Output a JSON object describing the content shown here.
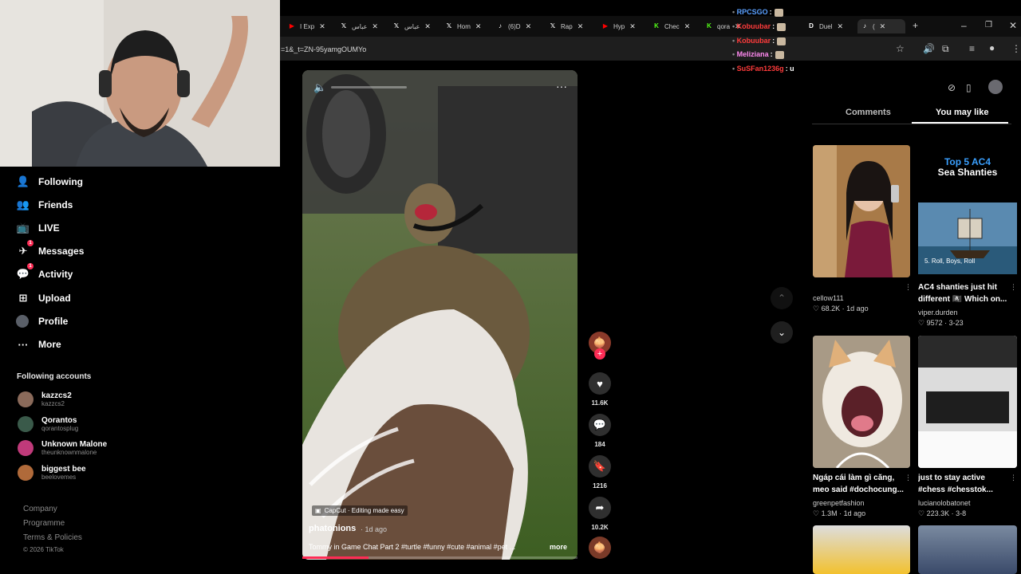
{
  "browser": {
    "tabs": [
      {
        "label": "I Exp",
        "icon": "youtube-icon",
        "color": "#ff0000"
      },
      {
        "label": "عباس",
        "icon": "x-logo-icon",
        "color": "#ffffff"
      },
      {
        "label": "عباس",
        "icon": "x-logo-icon",
        "color": "#ffffff"
      },
      {
        "label": "Hom",
        "icon": "x-logo-icon",
        "color": "#ffffff"
      },
      {
        "label": "(6)D",
        "icon": "tiktok-icon",
        "color": "#ffffff"
      },
      {
        "label": "Rap",
        "icon": "x-logo-icon",
        "color": "#ffffff"
      },
      {
        "label": "Hyp",
        "icon": "youtube-icon",
        "color": "#ff0000"
      },
      {
        "label": "Chec",
        "icon": "kick-icon",
        "color": "#53fc18"
      },
      {
        "label": "qora",
        "icon": "kick-icon",
        "color": "#53fc18"
      },
      {
        "label": "Duel",
        "icon": "d-icon",
        "color": "#ffffff"
      },
      {
        "label": "(",
        "icon": "tiktok-icon",
        "color": "#ffffff"
      }
    ],
    "url": "=1&_t=ZN-95yamgOUMYo"
  },
  "chat": [
    {
      "user": "RPCSGO",
      "text": ":",
      "color": "#5aa0ff"
    },
    {
      "user": "Kobuubar",
      "text": ":",
      "color": "#ff3b3b"
    },
    {
      "user": "Kobuubar",
      "text": ":",
      "color": "#ff3b3b"
    },
    {
      "user": "Meliziana",
      "text": ":",
      "color": "#ff8af0"
    },
    {
      "user": "SuSFan1236g",
      "text": ": u",
      "color": "#ff3b3b"
    }
  ],
  "sidebar": {
    "items": [
      {
        "label": "Following",
        "icon": "following-icon",
        "badge": "",
        "glyph": "👤"
      },
      {
        "label": "Friends",
        "icon": "friends-icon",
        "badge": "",
        "glyph": "👥"
      },
      {
        "label": "LIVE",
        "icon": "live-icon",
        "badge": "",
        "glyph": "📺"
      },
      {
        "label": "Messages",
        "icon": "messages-icon",
        "badge": "1",
        "glyph": "✈"
      },
      {
        "label": "Activity",
        "icon": "activity-icon",
        "badge": "1",
        "glyph": "💬"
      },
      {
        "label": "Upload",
        "icon": "upload-icon",
        "badge": "",
        "glyph": "⊞"
      },
      {
        "label": "Profile",
        "icon": "profile-avatar",
        "badge": "",
        "glyph": ""
      },
      {
        "label": "More",
        "icon": "more-icon",
        "badge": "",
        "glyph": "···"
      }
    ],
    "following_title": "Following accounts",
    "accounts": [
      {
        "name": "kazzcs2",
        "handle": "kazzcs2",
        "color": "#8a6a5a"
      },
      {
        "name": "Qorantos",
        "handle": "qorantosplug",
        "color": "#3a5a4a"
      },
      {
        "name": "Unknown Malone",
        "handle": "theunknownmalone",
        "color": "#c03a7a"
      },
      {
        "name": "biggest bee",
        "handle": "beelovemes",
        "color": "#b06a3a"
      }
    ],
    "footer": [
      "Company",
      "Programme",
      "Terms & Policies",
      "© 2026 TikTok"
    ]
  },
  "video": {
    "capcut_label": "CapCut · Editing made easy",
    "author": "phatonions",
    "time": "· 1d ago",
    "caption": "Tommy in Game Chat Part 2 #turtle #funny #cute #animal #pet ...",
    "more": "more",
    "progress": 0.24,
    "likes": "11.6K",
    "comments": "184",
    "saves": "1216",
    "shares": "10.2K"
  },
  "panel": {
    "tab_comments": "Comments",
    "tab_you_may_like": "You may like",
    "items": [
      {
        "title": "",
        "user": "cellow111",
        "meta": "♡ 68.2K · 1d ago",
        "thumb": "girl-photo"
      },
      {
        "title": "AC4 shanties just hit different 🏴‍☠️ Which on...",
        "user": "viper.durden",
        "meta": "♡ 9572 · 3-23",
        "thumb": "ship",
        "thumb_title": "Top 5 AC4",
        "thumb_subtitle": "Sea Shanties",
        "thumb_caption": "5. Roll, Boys, Roll"
      },
      {
        "title": "Ngáp cái làm gì căng, meo said #dochocung...",
        "user": "greenpetfashion",
        "meta": "♡ 1.3M · 1d ago",
        "thumb": "cat"
      },
      {
        "title": "just to stay active #chess #chesstok...",
        "user": "lucianolobatonet",
        "meta": "♡ 223.3K · 3-8",
        "thumb": "chess"
      }
    ]
  }
}
